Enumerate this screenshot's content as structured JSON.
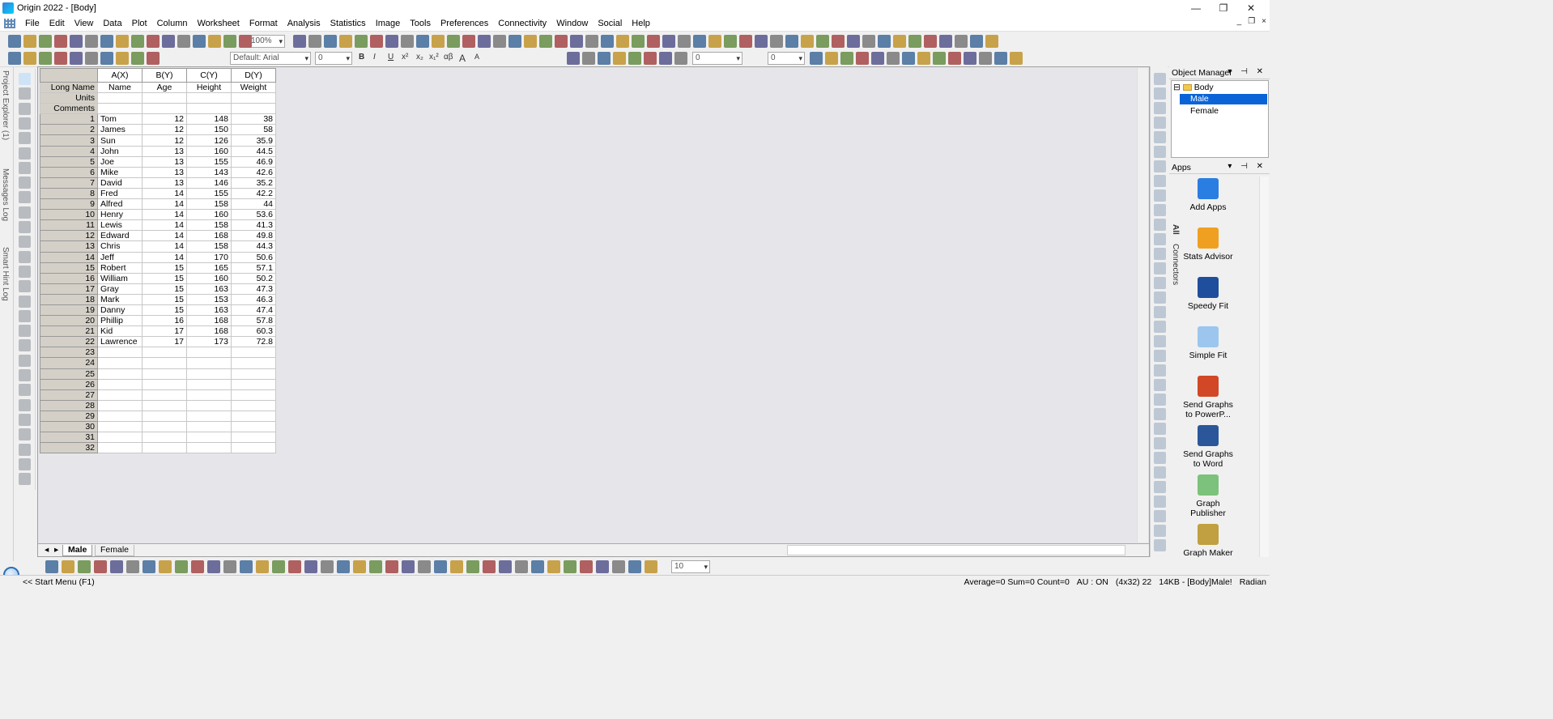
{
  "window": {
    "title": "Origin 2022 - [Body]",
    "controls": {
      "minimize": "—",
      "maximize": "❐",
      "close": "✕"
    },
    "mdi_controls": [
      "_",
      "❐",
      "×"
    ]
  },
  "menu": [
    "File",
    "Edit",
    "View",
    "Data",
    "Plot",
    "Column",
    "Worksheet",
    "Format",
    "Analysis",
    "Statistics",
    "Image",
    "Tools",
    "Preferences",
    "Connectivity",
    "Window",
    "Social",
    "Help"
  ],
  "toolbar": {
    "zoom": "100%",
    "font": "Default: Arial",
    "font_size": "0",
    "fmt_buttons": [
      "B",
      "I",
      "U",
      "x²",
      "x₂",
      "x₁²",
      "αβ",
      "A",
      "A"
    ],
    "line_width": "0",
    "line_width2": "0",
    "bottom_size": "10"
  },
  "left_dock": {
    "project_explorer": "Project Explorer (1)",
    "messages_log": "Messages Log",
    "smart_hint": "Smart Hint Log"
  },
  "worksheet": {
    "columns": [
      {
        "header": "A(X)",
        "long_name": "Name"
      },
      {
        "header": "B(Y)",
        "long_name": "Age"
      },
      {
        "header": "C(Y)",
        "long_name": "Height"
      },
      {
        "header": "D(Y)",
        "long_name": "Weight"
      }
    ],
    "label_rows": [
      "Long Name",
      "Units",
      "Comments"
    ],
    "rows": [
      [
        "Tom",
        "12",
        "148",
        "38"
      ],
      [
        "James",
        "12",
        "150",
        "58"
      ],
      [
        "Sun",
        "12",
        "126",
        "35.9"
      ],
      [
        "John",
        "13",
        "160",
        "44.5"
      ],
      [
        "Joe",
        "13",
        "155",
        "46.9"
      ],
      [
        "Mike",
        "13",
        "143",
        "42.6"
      ],
      [
        "David",
        "13",
        "146",
        "35.2"
      ],
      [
        "Fred",
        "14",
        "155",
        "42.2"
      ],
      [
        "Alfred",
        "14",
        "158",
        "44"
      ],
      [
        "Henry",
        "14",
        "160",
        "53.6"
      ],
      [
        "Lewis",
        "14",
        "158",
        "41.3"
      ],
      [
        "Edward",
        "14",
        "168",
        "49.8"
      ],
      [
        "Chris",
        "14",
        "158",
        "44.3"
      ],
      [
        "Jeff",
        "14",
        "170",
        "50.6"
      ],
      [
        "Robert",
        "15",
        "165",
        "57.1"
      ],
      [
        "William",
        "15",
        "160",
        "50.2"
      ],
      [
        "Gray",
        "15",
        "163",
        "47.3"
      ],
      [
        "Mark",
        "15",
        "153",
        "46.3"
      ],
      [
        "Danny",
        "15",
        "163",
        "47.4"
      ],
      [
        "Phillip",
        "16",
        "168",
        "57.8"
      ],
      [
        "Kid",
        "17",
        "168",
        "60.3"
      ],
      [
        "Lawrence",
        "17",
        "173",
        "72.8"
      ]
    ],
    "empty_rows": [
      "23",
      "24",
      "25",
      "26",
      "27",
      "28",
      "29",
      "30",
      "31",
      "32"
    ],
    "sheets": [
      "Male",
      "Female"
    ],
    "active_sheet": "Male"
  },
  "object_manager": {
    "title": "Object Manager",
    "root": "Body",
    "children": [
      "Male",
      "Female"
    ],
    "selected": "Male"
  },
  "apps": {
    "title": "Apps",
    "tabs": [
      "All",
      "Connectors"
    ],
    "items": [
      {
        "label": "Add Apps",
        "icon": "add-apps-icon",
        "color": "#2a7de1"
      },
      {
        "label": "Stats Advisor",
        "icon": "magic-wand-icon",
        "color": "#f0a020"
      },
      {
        "label": "Speedy Fit",
        "icon": "speedy-fit-icon",
        "color": "#1f4e9c"
      },
      {
        "label": "Simple Fit",
        "icon": "simple-fit-icon",
        "color": "#9cc6ee"
      },
      {
        "label": "Send Graphs to PowerP...",
        "icon": "powerpoint-icon",
        "color": "#d24726"
      },
      {
        "label": "Send Graphs to Word",
        "icon": "word-icon",
        "color": "#2b579a"
      },
      {
        "label": "Graph Publisher",
        "icon": "graph-publisher-icon",
        "color": "#7cc27c"
      },
      {
        "label": "Graph Maker",
        "icon": "graph-maker-icon",
        "color": "#c0a040"
      }
    ]
  },
  "status": {
    "left": "<< Start Menu (F1)",
    "stats": "Average=0 Sum=0 Count=0",
    "au": "AU : ON",
    "size": "(4x32) 22",
    "mem": "14KB - [Body]Male!",
    "angle": "Radian"
  },
  "colors": {
    "selection": "#0a64d8",
    "label_row": "#ffffcc",
    "header": "#d4d0c8"
  }
}
